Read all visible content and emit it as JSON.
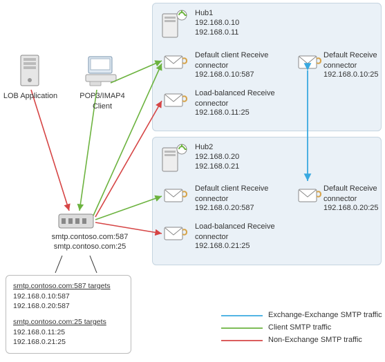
{
  "clients": {
    "lob_label": "LOB Application",
    "pop_label": "POP3/IMAP4\nClient"
  },
  "switch": {
    "line1": "smtp.contoso.com:587",
    "line2": "smtp.contoso.com:25"
  },
  "hub1": {
    "name": "Hub1",
    "ip1": "192.168.0.10",
    "ip2": "192.168.0.11",
    "client_conn_name": "Default client Receive\nconnector",
    "client_conn_addr": "192.168.0.10:587",
    "lb_conn_name": "Load-balanced Receive\nconnector",
    "lb_conn_addr": "192.168.0.11:25",
    "def_conn_name": "Default Receive\nconnector",
    "def_conn_addr": "192.168.0.10:25"
  },
  "hub2": {
    "name": "Hub2",
    "ip1": "192.168.0.20",
    "ip2": "192.168.0.21",
    "client_conn_name": "Default client Receive\nconnector",
    "client_conn_addr": "192.168.0.20:587",
    "lb_conn_name": "Load-balanced Receive\nconnector",
    "lb_conn_addr": "192.168.0.21:25",
    "def_conn_name": "Default Receive\nconnector",
    "def_conn_addr": "192.168.0.20:25"
  },
  "targets": {
    "t587_header": "smtp.contoso.com:587 targets",
    "t587_1": "192.168.0.10:587",
    "t587_2": "192.168.0.20:587",
    "t25_header": "smtp.contoso.com:25 targets",
    "t25_1": "192.168.0.11:25",
    "t25_2": "192.168.0.21:25"
  },
  "legend": {
    "ex": "Exchange-Exchange SMTP traffic",
    "client": "Client SMTP traffic",
    "nonex": "Non-Exchange SMTP traffic"
  },
  "chart_data": {
    "type": "network-diagram",
    "nodes": [
      {
        "id": "lob",
        "label": "LOB Application",
        "kind": "client"
      },
      {
        "id": "pop",
        "label": "POP3/IMAP4 Client",
        "kind": "client"
      },
      {
        "id": "sw",
        "label": "smtp.contoso.com",
        "kind": "switch",
        "ports": [
          587,
          25
        ]
      },
      {
        "id": "hub1",
        "label": "Hub1",
        "ips": [
          "192.168.0.10",
          "192.168.0.11"
        ],
        "kind": "server"
      },
      {
        "id": "hub2",
        "label": "Hub2",
        "ips": [
          "192.168.0.20",
          "192.168.0.21"
        ],
        "kind": "server"
      },
      {
        "id": "h1c",
        "label": "Default client Receive connector",
        "addr": "192.168.0.10:587",
        "parent": "hub1"
      },
      {
        "id": "h1l",
        "label": "Load-balanced Receive connector",
        "addr": "192.168.0.11:25",
        "parent": "hub1"
      },
      {
        "id": "h1d",
        "label": "Default Receive connector",
        "addr": "192.168.0.10:25",
        "parent": "hub1"
      },
      {
        "id": "h2c",
        "label": "Default client Receive connector",
        "addr": "192.168.0.20:587",
        "parent": "hub2"
      },
      {
        "id": "h2l",
        "label": "Load-balanced Receive connector",
        "addr": "192.168.0.21:25",
        "parent": "hub2"
      },
      {
        "id": "h2d",
        "label": "Default Receive connector",
        "addr": "192.168.0.20:25",
        "parent": "hub2"
      }
    ],
    "edges": [
      {
        "from": "lob",
        "to": "sw",
        "type": "non-exchange"
      },
      {
        "from": "pop",
        "to": "sw",
        "type": "client"
      },
      {
        "from": "pop",
        "to": "h1c",
        "type": "client"
      },
      {
        "from": "sw",
        "to": "h1c",
        "type": "client"
      },
      {
        "from": "sw",
        "to": "h2c",
        "type": "client"
      },
      {
        "from": "sw",
        "to": "h1l",
        "type": "non-exchange"
      },
      {
        "from": "sw",
        "to": "h2l",
        "type": "non-exchange"
      },
      {
        "from": "h1d",
        "to": "h2d",
        "type": "exchange",
        "bidirectional": true
      }
    ],
    "dns_targets": {
      "smtp.contoso.com:587": [
        "192.168.0.10:587",
        "192.168.0.20:587"
      ],
      "smtp.contoso.com:25": [
        "192.168.0.11:25",
        "192.168.0.21:25"
      ]
    },
    "legend": {
      "exchange": "#3aa9e0",
      "client": "#6cb33f",
      "non-exchange": "#d64545"
    }
  }
}
